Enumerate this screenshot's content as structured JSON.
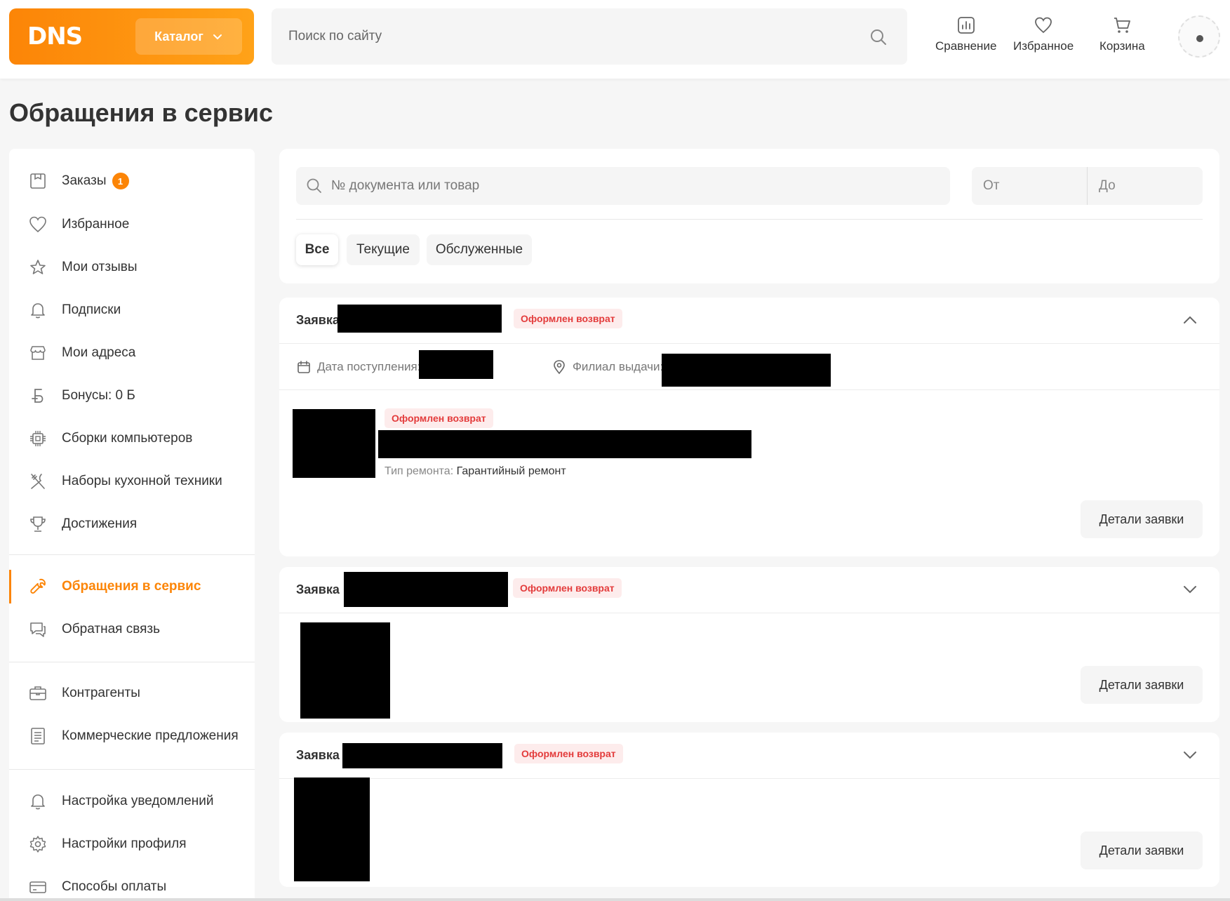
{
  "header": {
    "logo": "DNS",
    "catalog_label": "Каталог",
    "search_placeholder": "Поиск по сайту",
    "actions": [
      {
        "label": "Сравнение",
        "icon": "compare-icon"
      },
      {
        "label": "Избранное",
        "icon": "heart-icon"
      },
      {
        "label": "Корзина",
        "icon": "cart-icon"
      }
    ]
  },
  "page": {
    "title": "Обращения в сервис"
  },
  "sidebar": {
    "items": [
      {
        "label": "Заказы",
        "icon": "orders-icon",
        "badge": "1"
      },
      {
        "label": "Избранное",
        "icon": "heart-icon"
      },
      {
        "label": "Мои отзывы",
        "icon": "star-icon"
      },
      {
        "label": "Подписки",
        "icon": "bell-icon"
      },
      {
        "label": "Мои адреса",
        "icon": "store-icon"
      },
      {
        "label": "Бонусы: 0 Б",
        "icon": "bonus-icon"
      },
      {
        "label": "Сборки компьютеров",
        "icon": "chip-icon"
      },
      {
        "label": "Наборы кухонной техники",
        "icon": "kitchen-icon"
      },
      {
        "label": "Достижения",
        "icon": "trophy-icon"
      },
      {
        "label": "Обращения в сервис",
        "icon": "wrench-icon",
        "active": true
      },
      {
        "label": "Обратная связь",
        "icon": "chat-icon"
      },
      {
        "label": "Контрагенты",
        "icon": "briefcase-icon"
      },
      {
        "label": "Коммерческие предложения",
        "icon": "document-icon"
      },
      {
        "label": "Настройка уведомлений",
        "icon": "bell-icon"
      },
      {
        "label": "Настройки профиля",
        "icon": "gear-icon"
      },
      {
        "label": "Способы оплаты",
        "icon": "card-icon"
      }
    ]
  },
  "filters": {
    "search_placeholder": "№ документа или товар",
    "date_from_placeholder": "От",
    "date_to_placeholder": "До",
    "tabs": [
      {
        "label": "Все",
        "active": true
      },
      {
        "label": "Текущие"
      },
      {
        "label": "Обслуженные"
      }
    ]
  },
  "requests": [
    {
      "title": "Заявка",
      "status": "Оформлен возврат",
      "expanded": true,
      "date_label": "Дата поступления:",
      "branch_label": "Филиал выдачи:",
      "item_status": "Оформлен возврат",
      "repair_label": "Тип ремонта:",
      "repair_value": "Гарантийный ремонт",
      "details_label": "Детали заявки"
    },
    {
      "title": "Заявка",
      "status": "Оформлен возврат",
      "expanded": false,
      "details_label": "Детали заявки"
    },
    {
      "title": "Заявка",
      "status": "Оформлен возврат",
      "expanded": false,
      "details_label": "Детали заявки"
    }
  ],
  "colors": {
    "accent": "#fc8507",
    "status_text": "#e33b3b",
    "status_bg": "#fdecec"
  }
}
